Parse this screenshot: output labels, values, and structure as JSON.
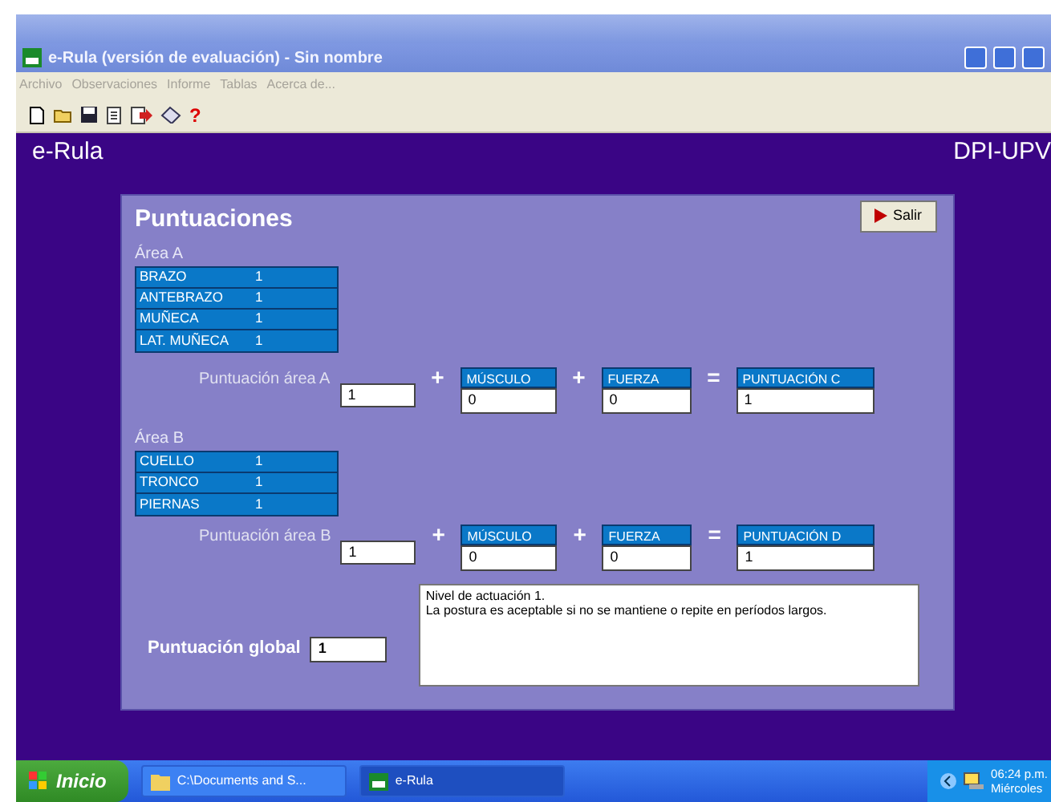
{
  "window": {
    "title": "e-Rula (versión de evaluación) - Sin nombre"
  },
  "menu": [
    {
      "label": "Archivo"
    },
    {
      "label": "Observaciones"
    },
    {
      "label": "Informe"
    },
    {
      "label": "Tablas"
    },
    {
      "label": "Acerca de..."
    }
  ],
  "toolbar": {
    "help": "?"
  },
  "header": {
    "app": "e-Rula",
    "org": "DPI-UPV"
  },
  "panel": {
    "title": "Puntuaciones",
    "exit_button": "Salir",
    "areas": [
      {
        "label": "Área A",
        "rows": [
          {
            "name": "BRAZO",
            "value": "1"
          },
          {
            "name": "ANTEBRAZO",
            "value": "1"
          },
          {
            "name": "MUÑECA",
            "value": "1"
          },
          {
            "name": "LAT. MUÑECA",
            "value": "1"
          }
        ],
        "score_label": "Puntuación área A",
        "score": "1",
        "ops": [
          "+",
          "+",
          "="
        ],
        "boxes": [
          {
            "label": "MÚSCULO",
            "value": "0"
          },
          {
            "label": "FUERZA",
            "value": "0"
          },
          {
            "label": "PUNTUACIÓN C",
            "value": "1"
          }
        ]
      },
      {
        "label": "Área B",
        "rows": [
          {
            "name": "CUELLO",
            "value": "1"
          },
          {
            "name": "TRONCO",
            "value": "1"
          },
          {
            "name": "PIERNAS",
            "value": "1"
          }
        ],
        "score_label": "Puntuación área B",
        "score": "1",
        "ops": [
          "+",
          "+",
          "="
        ],
        "boxes": [
          {
            "label": "MÚSCULO",
            "value": "0"
          },
          {
            "label": "FUERZA",
            "value": "0"
          },
          {
            "label": "PUNTUACIÓN D",
            "value": "1"
          }
        ]
      }
    ],
    "global": {
      "label": "Puntuación global",
      "value": "1",
      "message": [
        "Nivel de actuación 1.",
        "La postura es aceptable si no se mantiene o repite en períodos largos."
      ]
    }
  },
  "taskbar": {
    "start": "Inicio",
    "tasks": [
      {
        "label": "C:\\Documents and S...",
        "selected": false
      },
      {
        "label": "e-Rula",
        "selected": true
      }
    ],
    "time": "06:24 p.m.",
    "day": "Miércoles"
  }
}
